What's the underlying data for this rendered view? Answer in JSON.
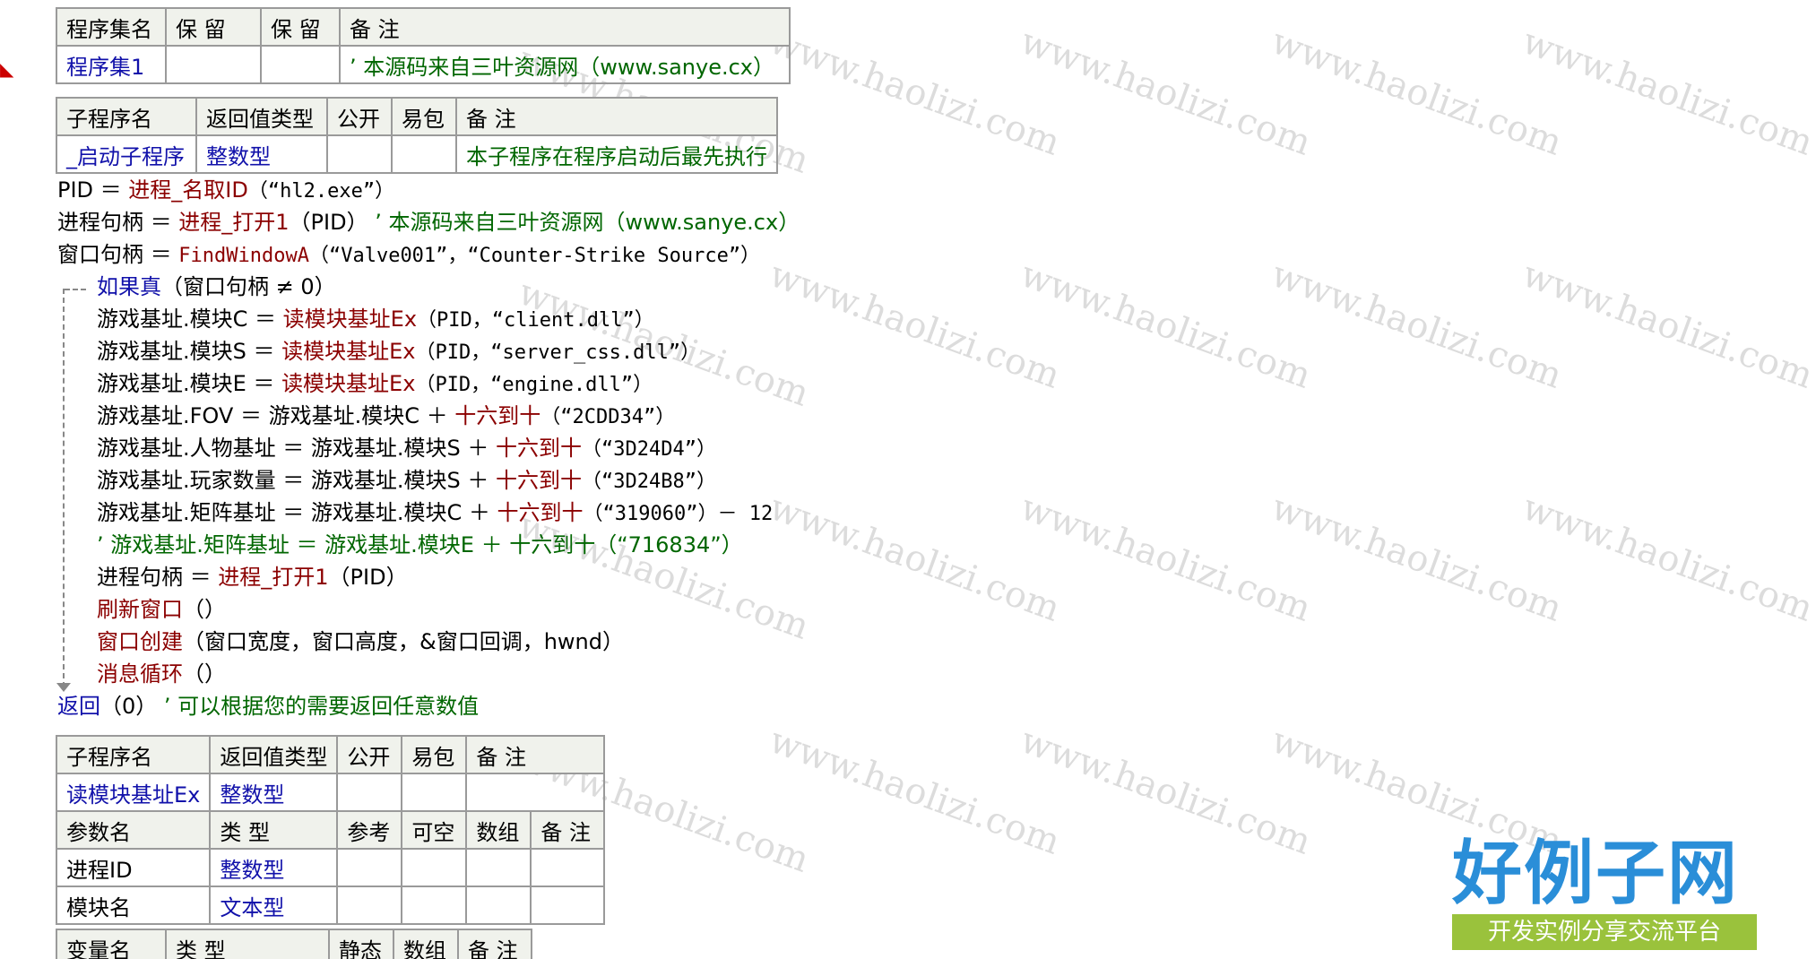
{
  "watermark": "www.haolizi.com",
  "assembly": {
    "headers": [
      "程序集名",
      "保 留",
      "保 留",
      "备 注"
    ],
    "row": [
      "程序集1",
      "",
      "",
      "’ 本源码来自三叶资源网（www.sanye.cx）"
    ]
  },
  "sub1": {
    "headers": [
      "子程序名",
      "返回值类型",
      "公开",
      "易包",
      "备 注"
    ],
    "row": [
      "_启动子程序",
      "整数型",
      "",
      "",
      "本子程序在程序启动后最先执行"
    ]
  },
  "code": {
    "l1a": "PID ＝ ",
    "l1f": "进程_名取ID",
    "l1s": "（“hl2.exe”）",
    "l2a": "进程句柄 ＝ ",
    "l2f": "进程_打开1",
    "l2b": "（PID）",
    "l2c": "’ 本源码来自三叶资源网（www.sanye.cx）",
    "l3a": "窗口句柄 ＝ ",
    "l3f": "FindWindowA",
    "l3s": "（“Valve001”，“Counter-Strike Source”）",
    "l4k": "如果真",
    "l4b": "（窗口句柄 ≠ 0）",
    "l5a": "游戏基址.模块C ＝ ",
    "l5f": "读模块基址Ex",
    "l5s": "（PID，“client.dll”）",
    "l6a": "游戏基址.模块S ＝ ",
    "l6f": "读模块基址Ex",
    "l6s": "（PID，“server_css.dll”）",
    "l7a": "游戏基址.模块E ＝ ",
    "l7f": "读模块基址Ex",
    "l7s": "（PID，“engine.dll”）",
    "l8a": "游戏基址.FOV ＝ 游戏基址.模块C ＋ ",
    "l8f": "十六到十",
    "l8s": "（“2CDD34”）",
    "l9a": "游戏基址.人物基址 ＝ 游戏基址.模块S ＋ ",
    "l9f": "十六到十",
    "l9s": "（“3D24D4”）",
    "l10a": "游戏基址.玩家数量 ＝ 游戏基址.模块S ＋ ",
    "l10f": "十六到十",
    "l10s": "（“3D24B8”）",
    "l11a": "游戏基址.矩阵基址 ＝ 游戏基址.模块C ＋ ",
    "l11f": "十六到十",
    "l11s": "（“319060”）－ 12",
    "l12c": "’ 游戏基址.矩阵基址 ＝ 游戏基址.模块E ＋ 十六到十（“716834”）",
    "l13a": "进程句柄 ＝ ",
    "l13f": "进程_打开1",
    "l13b": "（PID）",
    "l14f": "刷新窗口",
    "l14b": "（）",
    "l15f": "窗口创建",
    "l15b": "（窗口宽度，窗口高度，&窗口回调，hwnd）",
    "l16f": "消息循环",
    "l16b": "（）",
    "l17k": "返回",
    "l17b": "（0）",
    "l17c": "’ 可以根据您的需要返回任意数值"
  },
  "sub2": {
    "headers": [
      "子程序名",
      "返回值类型",
      "公开",
      "易包",
      "备 注"
    ],
    "row": [
      "读模块基址Ex",
      "整数型",
      "",
      "",
      ""
    ],
    "param_headers": [
      "参数名",
      "类 型",
      "参考",
      "可空",
      "数组",
      "备 注"
    ],
    "params": [
      [
        "进程ID",
        "整数型",
        "",
        "",
        "",
        ""
      ],
      [
        "模块名",
        "文本型",
        "",
        "",
        "",
        ""
      ]
    ]
  },
  "vars": {
    "headers": [
      "变量名",
      "类 型",
      "静态",
      "数组",
      "备 注"
    ]
  },
  "logo": {
    "main": "好例子网",
    "sub": "开发实例分享交流平台"
  }
}
